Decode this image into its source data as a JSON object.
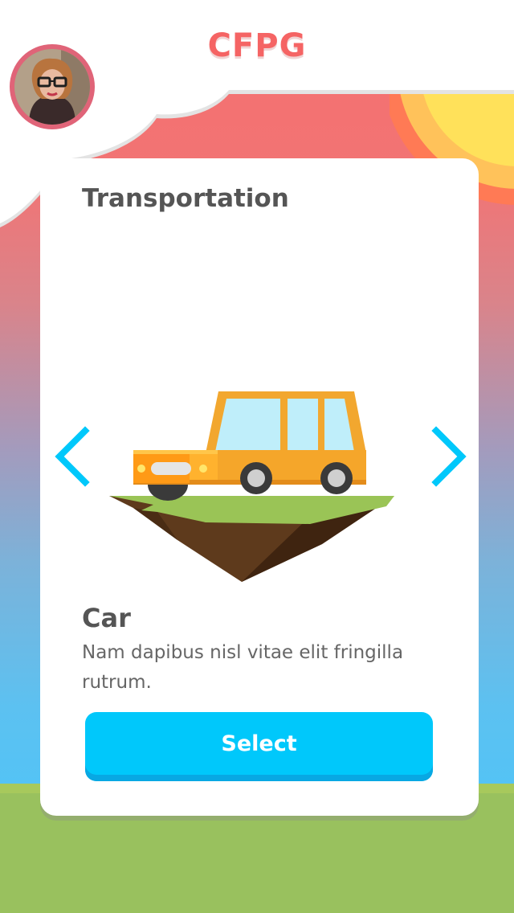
{
  "header": {
    "brand": "CFPG",
    "avatar_icon": "user-avatar"
  },
  "card": {
    "title": "Transportation",
    "item": {
      "name": "Car",
      "description": "Nam dapibus nisl vitae elit fringilla rutrum.",
      "illustration_icon": "car-on-floating-island"
    },
    "select_label": "Select",
    "prev_icon": "chevron-left-icon",
    "next_icon": "chevron-right-icon"
  },
  "colors": {
    "brand": "#f56464",
    "accent_button": "#00c8fb",
    "arrow": "#00c8fb",
    "sky_top": "#f56f6f",
    "sky_bottom": "#54c3f5",
    "ground": "#99c15e",
    "sun": "#ffe15a"
  }
}
